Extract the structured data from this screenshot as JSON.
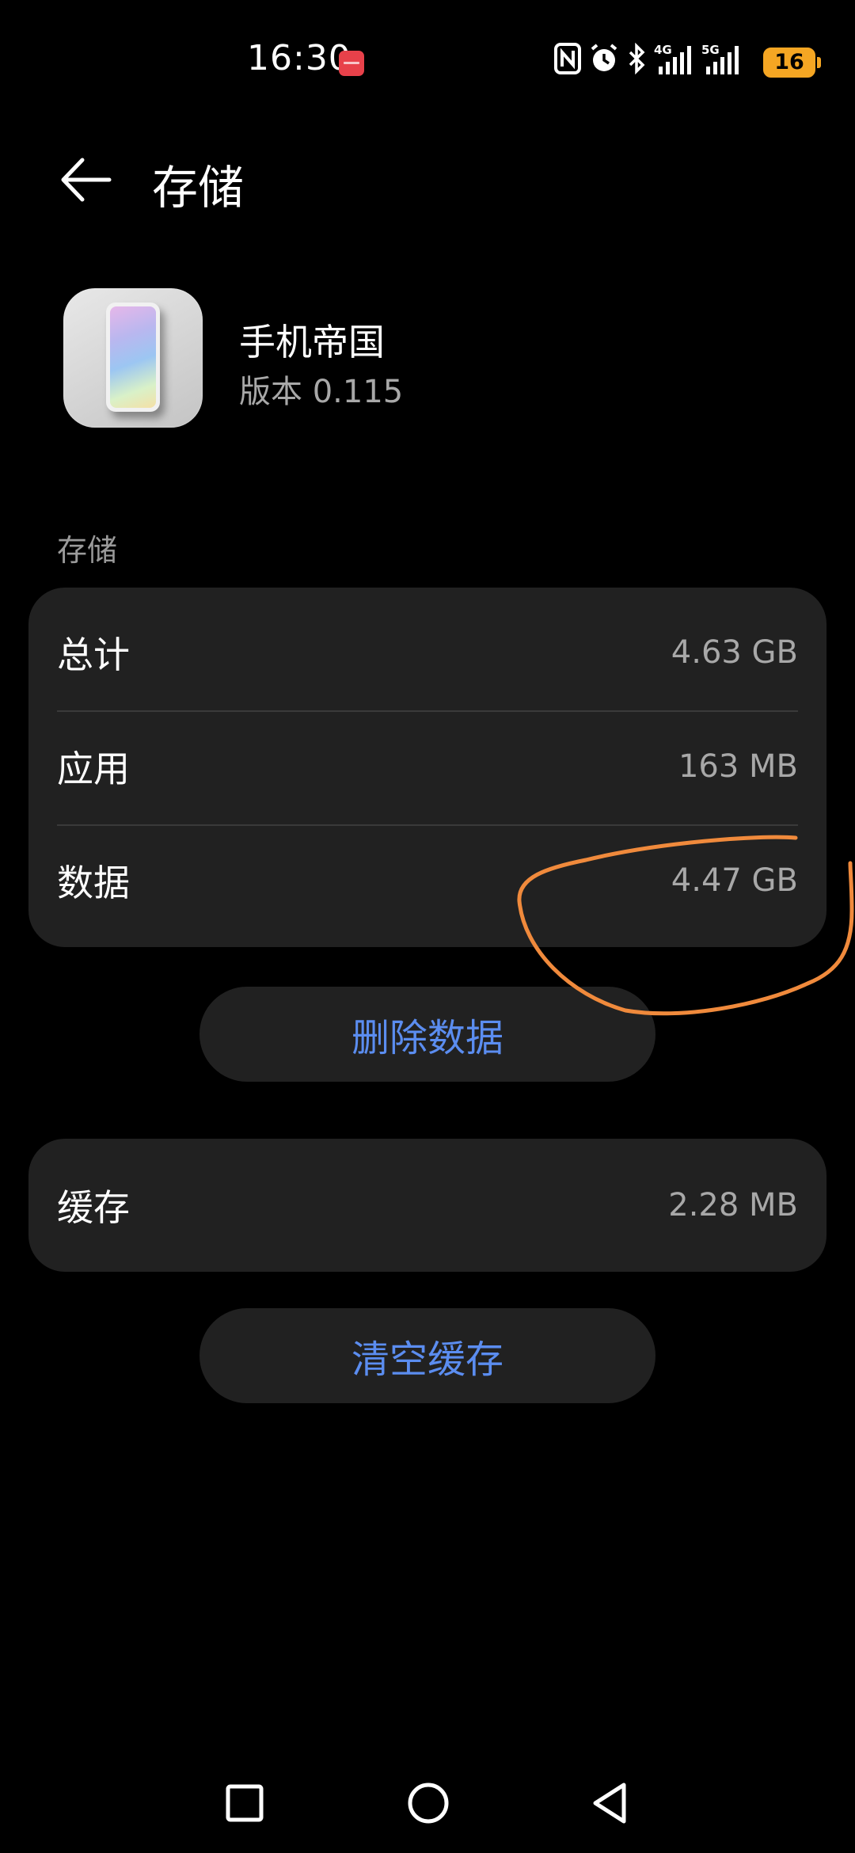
{
  "status_bar": {
    "time": "16:30",
    "battery": "16",
    "network_4g": "4G",
    "network_5g": "5G"
  },
  "header": {
    "title": "存储",
    "back_icon": "arrow-left-icon"
  },
  "app": {
    "name": "手机帝国",
    "version": "版本 0.115"
  },
  "storage": {
    "section_label": "存储",
    "rows": [
      {
        "label": "总计",
        "value": "4.63 GB"
      },
      {
        "label": "应用",
        "value": "163 MB"
      },
      {
        "label": "数据",
        "value": "4.47 GB"
      }
    ],
    "delete_button": "删除数据"
  },
  "cache": {
    "label": "缓存",
    "value": "2.28 MB",
    "clear_button": "清空缓存"
  },
  "colors": {
    "background": "#000000",
    "card": "#212121",
    "accent": "#5b8df0",
    "annotation_stroke": "#f08a3c",
    "battery": "#f5a623"
  },
  "nav": {
    "recent_icon": "square-recent-apps-icon",
    "home_icon": "circle-home-icon",
    "back_icon": "triangle-back-icon"
  }
}
